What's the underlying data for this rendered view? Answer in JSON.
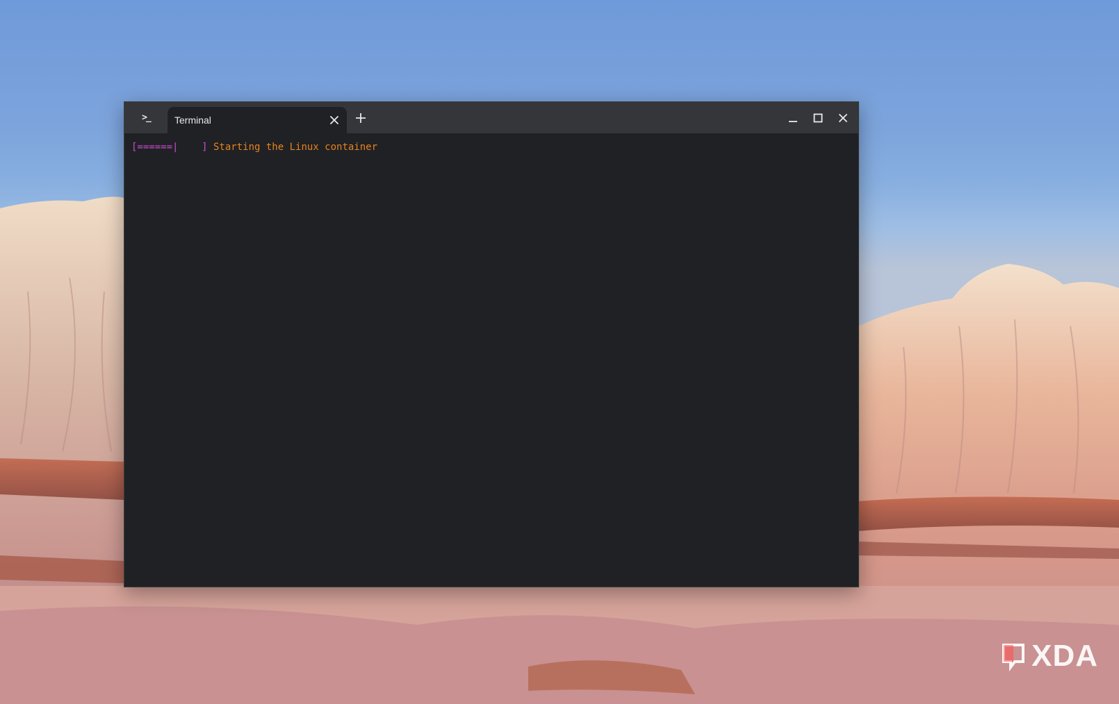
{
  "window": {
    "app_icon": "terminal-prompt-icon",
    "tab": {
      "title": "Terminal",
      "close_icon": "close-icon"
    },
    "new_tab_icon": "plus-icon",
    "controls": {
      "minimize_icon": "minimize-icon",
      "maximize_icon": "maximize-icon",
      "close_icon": "close-icon"
    }
  },
  "terminal": {
    "progress_bar": "[======|    ]",
    "status_text": " Starting the Linux container"
  },
  "watermark": {
    "text": "XDA"
  },
  "colors": {
    "terminal_bg": "#202124",
    "titlebar_bg": "#35363a",
    "progress": "#c94cd3",
    "status": "#e8831e"
  }
}
